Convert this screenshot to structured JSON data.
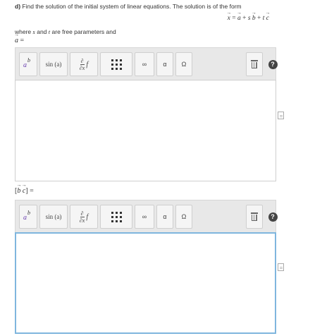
{
  "question": {
    "part_label": "d)",
    "text": "Find the solution of the initial system of linear equations. The solution is of the form",
    "formula": {
      "x": "x",
      "eq": "=",
      "a": "a",
      "plus1": "+",
      "s": "s",
      "b": "b",
      "plus2": "+",
      "t": "t",
      "c": "c"
    },
    "where_prefix": "where",
    "where_s": "s",
    "where_and": "and",
    "where_t": "t",
    "where_suffix": "are free parameters and"
  },
  "fields": [
    {
      "label_parts": {
        "open": "",
        "v1": "a",
        "v2": "",
        "close": "",
        "eq": "="
      }
    },
    {
      "label_parts": {
        "open": "[",
        "v1": "b",
        "v2": "c",
        "close": "]",
        "eq": "="
      }
    }
  ],
  "toolbar": {
    "superscript_base": "a",
    "superscript_exp": "b",
    "sin_label": "sin (a)",
    "deriv_num": "∂",
    "deriv_den": "∂x",
    "deriv_f": "f",
    "infinity_label": "∞",
    "alpha_label": "α",
    "omega_label": "Ω",
    "help_label": "?"
  }
}
